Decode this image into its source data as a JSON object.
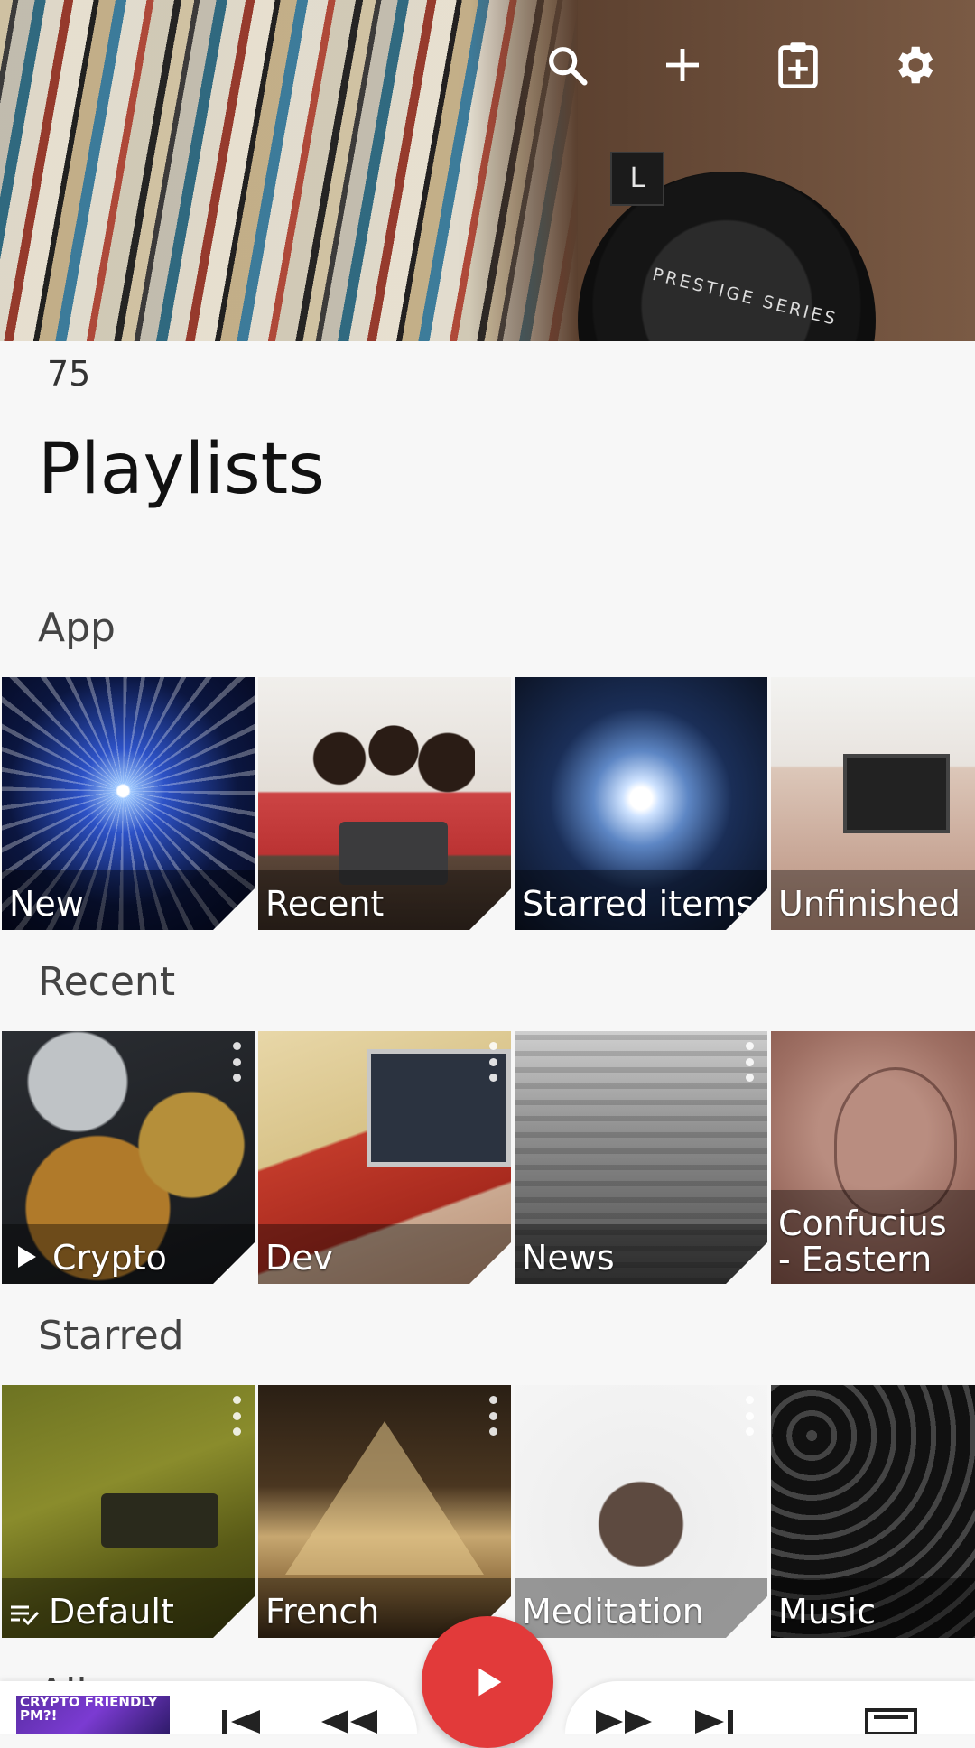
{
  "header": {
    "count": "75",
    "title": "Playlists",
    "actions": [
      "search-icon",
      "add-icon",
      "clipboard-add-icon",
      "settings-icon"
    ],
    "art_text": {
      "headphone_badge": "L",
      "headphone_brand": "PRESTIGE SERIES"
    }
  },
  "sections": {
    "app": {
      "title": "App",
      "tiles": [
        {
          "label": "New"
        },
        {
          "label": "Recent"
        },
        {
          "label": "Starred items"
        },
        {
          "label": "Unfinished"
        }
      ]
    },
    "recent": {
      "title": "Recent",
      "tiles": [
        {
          "label": "Crypto"
        },
        {
          "label": "Dev"
        },
        {
          "label": "News"
        },
        {
          "label": "Confucius - Eastern"
        }
      ]
    },
    "starred": {
      "title": "Starred",
      "tiles": [
        {
          "label": "Default"
        },
        {
          "label": "French"
        },
        {
          "label": "Meditation"
        },
        {
          "label": "Music"
        }
      ]
    },
    "all": {
      "title": "All"
    }
  },
  "player": {
    "thumbnail_text": "CRYPTO FRIENDLY PM?!",
    "controls": [
      "skip-previous-icon",
      "rewind-icon",
      "play-icon",
      "fast-forward-icon",
      "skip-next-icon",
      "queue-icon"
    ]
  },
  "colors": {
    "accent": "#e23a3a",
    "background": "#f7f7f7",
    "text": "#1c1c1c"
  }
}
